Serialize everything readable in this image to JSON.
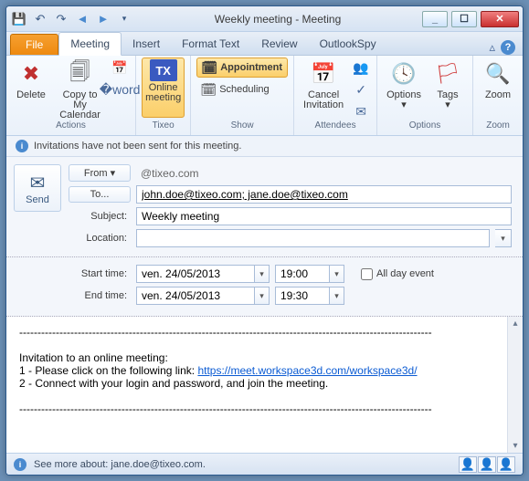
{
  "window": {
    "title": "Weekly meeting  -  Meeting"
  },
  "tabs": {
    "file": "File",
    "items": [
      "Meeting",
      "Insert",
      "Format Text",
      "Review",
      "OutlookSpy"
    ],
    "active": 0
  },
  "ribbon": {
    "actions": {
      "label": "Actions",
      "delete": "Delete",
      "copy": "Copy to My\nCalendar"
    },
    "tixeo": {
      "label": "Tixeo",
      "online": "Online\nmeeting"
    },
    "show": {
      "label": "Show",
      "appointment": "Appointment",
      "scheduling": "Scheduling"
    },
    "attendees": {
      "label": "Attendees",
      "cancel": "Cancel\nInvitation"
    },
    "options": {
      "label_group": "Options",
      "options": "Options",
      "tags": "Tags"
    },
    "zoom": {
      "label": "Zoom",
      "zoom": "Zoom"
    }
  },
  "infobar": "Invitations have not been sent for this meeting.",
  "form": {
    "send": "Send",
    "from_label": "From",
    "from_value": "      @tixeo.com",
    "to_label": "To...",
    "to_value": "john.doe@tixeo.com; jane.doe@tixeo.com",
    "subject_label": "Subject:",
    "subject_value": "Weekly meeting",
    "location_label": "Location:",
    "location_value": ""
  },
  "time": {
    "start_label": "Start time:",
    "start_date": "ven. 24/05/2013",
    "start_time": "19:00",
    "end_label": "End time:",
    "end_date": "ven. 24/05/2013",
    "end_time": "19:30",
    "allday": "All day event"
  },
  "body": {
    "intro": "Invitation to an online meeting:",
    "line1_pre": "1 - Please click on the following link: ",
    "line1_link": "https://meet.workspace3d.com/workspace3d/",
    "line2": "2 - Connect with your login and password, and join the meeting."
  },
  "status": {
    "text": "See more about: jane.doe@tixeo.com."
  }
}
